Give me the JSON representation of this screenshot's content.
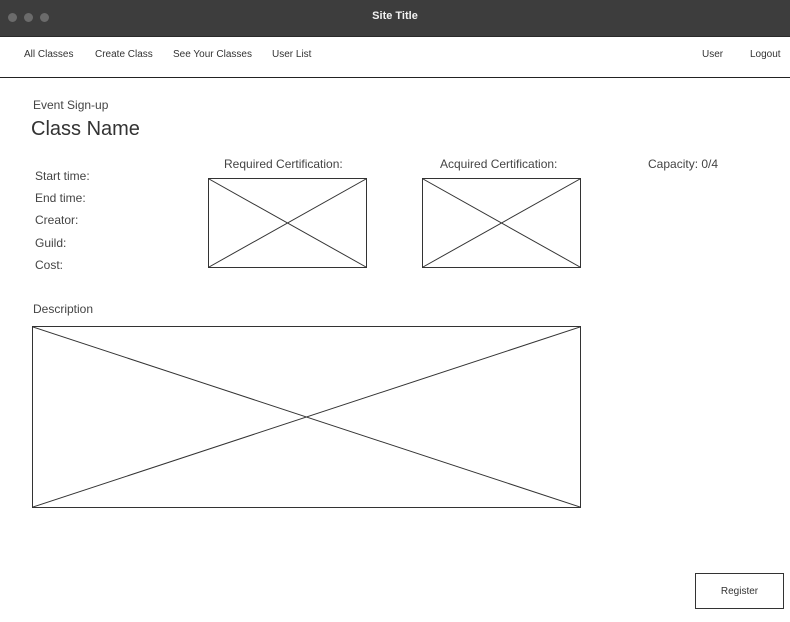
{
  "window": {
    "title": "Site Title"
  },
  "nav": {
    "left": [
      "All Classes",
      "Create Class",
      "See Your Classes",
      "User List"
    ],
    "user": "User",
    "logout": "Logout"
  },
  "page": {
    "eyebrow": "Event Sign-up",
    "class_name": "Class Name",
    "fields": [
      "Start time:",
      "End time:",
      "Creator:",
      "Guild:",
      "Cost:"
    ],
    "required_cert_label": "Required Certification:",
    "acquired_cert_label": "Acquired Certification:",
    "capacity": "Capacity: 0/4",
    "description_label": "Description",
    "register_label": "Register"
  }
}
